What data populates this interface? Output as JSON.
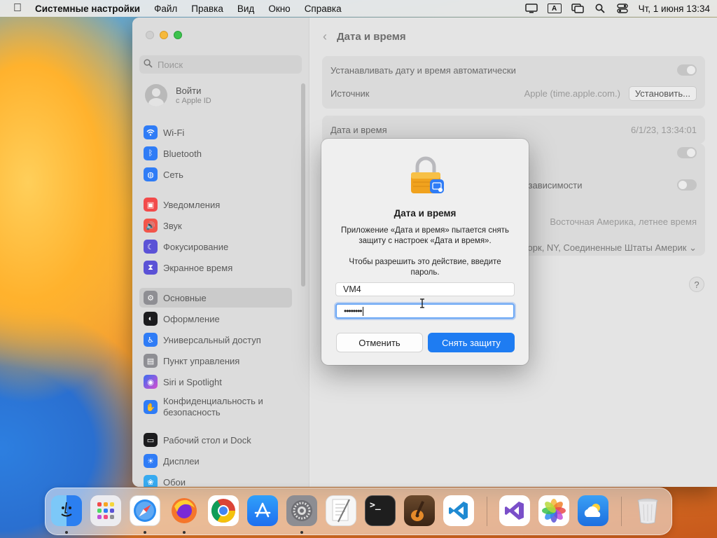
{
  "menubar": {
    "app_name": "Системные настройки",
    "menus": [
      "Файл",
      "Правка",
      "Вид",
      "Окно",
      "Справка"
    ],
    "clock": "Чт, 1 июня  13:34",
    "input_source": "A"
  },
  "sidebar": {
    "search_placeholder": "Поиск",
    "account": {
      "name": "Войти",
      "subtitle": "с Apple ID"
    },
    "items": [
      {
        "label": "Wi-Fi",
        "icon": "wifi-icon",
        "color": "#2f7cf6"
      },
      {
        "label": "Bluetooth",
        "icon": "bluetooth-icon",
        "color": "#2f7cf6"
      },
      {
        "label": "Сеть",
        "icon": "network-icon",
        "color": "#2f7cf6"
      },
      {
        "label": "Уведомления",
        "icon": "notifications-icon",
        "color": "#f24a4a"
      },
      {
        "label": "Звук",
        "icon": "sound-icon",
        "color": "#f2554a"
      },
      {
        "label": "Фокусирование",
        "icon": "focus-icon",
        "color": "#5b52d6"
      },
      {
        "label": "Экранное время",
        "icon": "screen-time-icon",
        "color": "#5b52d6"
      },
      {
        "label": "Основные",
        "icon": "gear-icon",
        "color": "#8e8e93"
      },
      {
        "label": "Оформление",
        "icon": "appearance-icon",
        "color": "#1c1c1e"
      },
      {
        "label": "Универсальный доступ",
        "icon": "accessibility-icon",
        "color": "#2f7cf6"
      },
      {
        "label": "Пункт управления",
        "icon": "control-center-icon",
        "color": "#8e8e93"
      },
      {
        "label": "Siri и Spotlight",
        "icon": "siri-icon",
        "color": "#c04fd8"
      },
      {
        "label": "Конфиденциальность и безопасность",
        "icon": "privacy-hand-icon",
        "color": "#2f7cf6"
      },
      {
        "label": "Рабочий стол и Dock",
        "icon": "desktop-dock-icon",
        "color": "#1c1c1e"
      },
      {
        "label": "Дисплеи",
        "icon": "displays-icon",
        "color": "#2f7cf6"
      },
      {
        "label": "Обои",
        "icon": "wallpaper-icon",
        "color": "#37aaf0"
      }
    ],
    "active_label": "Основные"
  },
  "main": {
    "title": "Дата и время",
    "auto_time_label": "Устанавливать дату и время автоматически",
    "source_label": "Источник",
    "source_value": "Apple (time.apple.com.)",
    "set_button": "Установить...",
    "datetime_label": "Дата и время",
    "datetime_value": "6/1/23, 13:34:01",
    "location_partial": "в зависимости",
    "timezone_value": "Восточная Америка, летнее время",
    "city_value": "орк, NY, Соединенные Штаты Америк",
    "help": "?"
  },
  "dialog": {
    "title": "Дата и время",
    "message": "Приложение «Дата и время» пытается снять защиту с настроек «Дата и время».",
    "prompt": "Чтобы разрешить это действие, введите пароль.",
    "username": "VM4",
    "password_mask": "••••••••",
    "cancel": "Отменить",
    "confirm": "Снять защиту"
  },
  "dock": {
    "apps": [
      {
        "name": "Finder",
        "icon": "finder-icon",
        "color": "#3d8ff0"
      },
      {
        "name": "Launchpad",
        "icon": "launchpad-icon",
        "color": "#e9e9ee"
      },
      {
        "name": "Safari",
        "icon": "safari-icon",
        "color": "#2b8cf0"
      },
      {
        "name": "Firefox",
        "icon": "firefox-icon",
        "color": "#e55b1c"
      },
      {
        "name": "Chrome",
        "icon": "chrome-icon",
        "color": "#ffffff"
      },
      {
        "name": "App Store",
        "icon": "app-store-icon",
        "color": "#1f8cf5"
      },
      {
        "name": "System Settings",
        "icon": "system-settings-icon",
        "color": "#8d8d92"
      },
      {
        "name": "TextEdit",
        "icon": "textedit-icon",
        "color": "#f4f4f4"
      },
      {
        "name": "Terminal",
        "icon": "terminal-icon",
        "color": "#1e1e1e"
      },
      {
        "name": "GarageBand",
        "icon": "garageband-icon",
        "color": "#5a3a22"
      },
      {
        "name": "VS Code",
        "icon": "vscode-icon",
        "color": "#ffffff"
      },
      {
        "name": "Visual Studio",
        "icon": "visual-studio-icon",
        "color": "#ffffff"
      },
      {
        "name": "Photos",
        "icon": "photos-icon",
        "color": "#ffffff"
      },
      {
        "name": "Weather",
        "icon": "weather-icon",
        "color": "#2f8cf0"
      },
      {
        "name": "Trash",
        "icon": "trash-icon",
        "color": "#e6e6e6"
      }
    ]
  }
}
